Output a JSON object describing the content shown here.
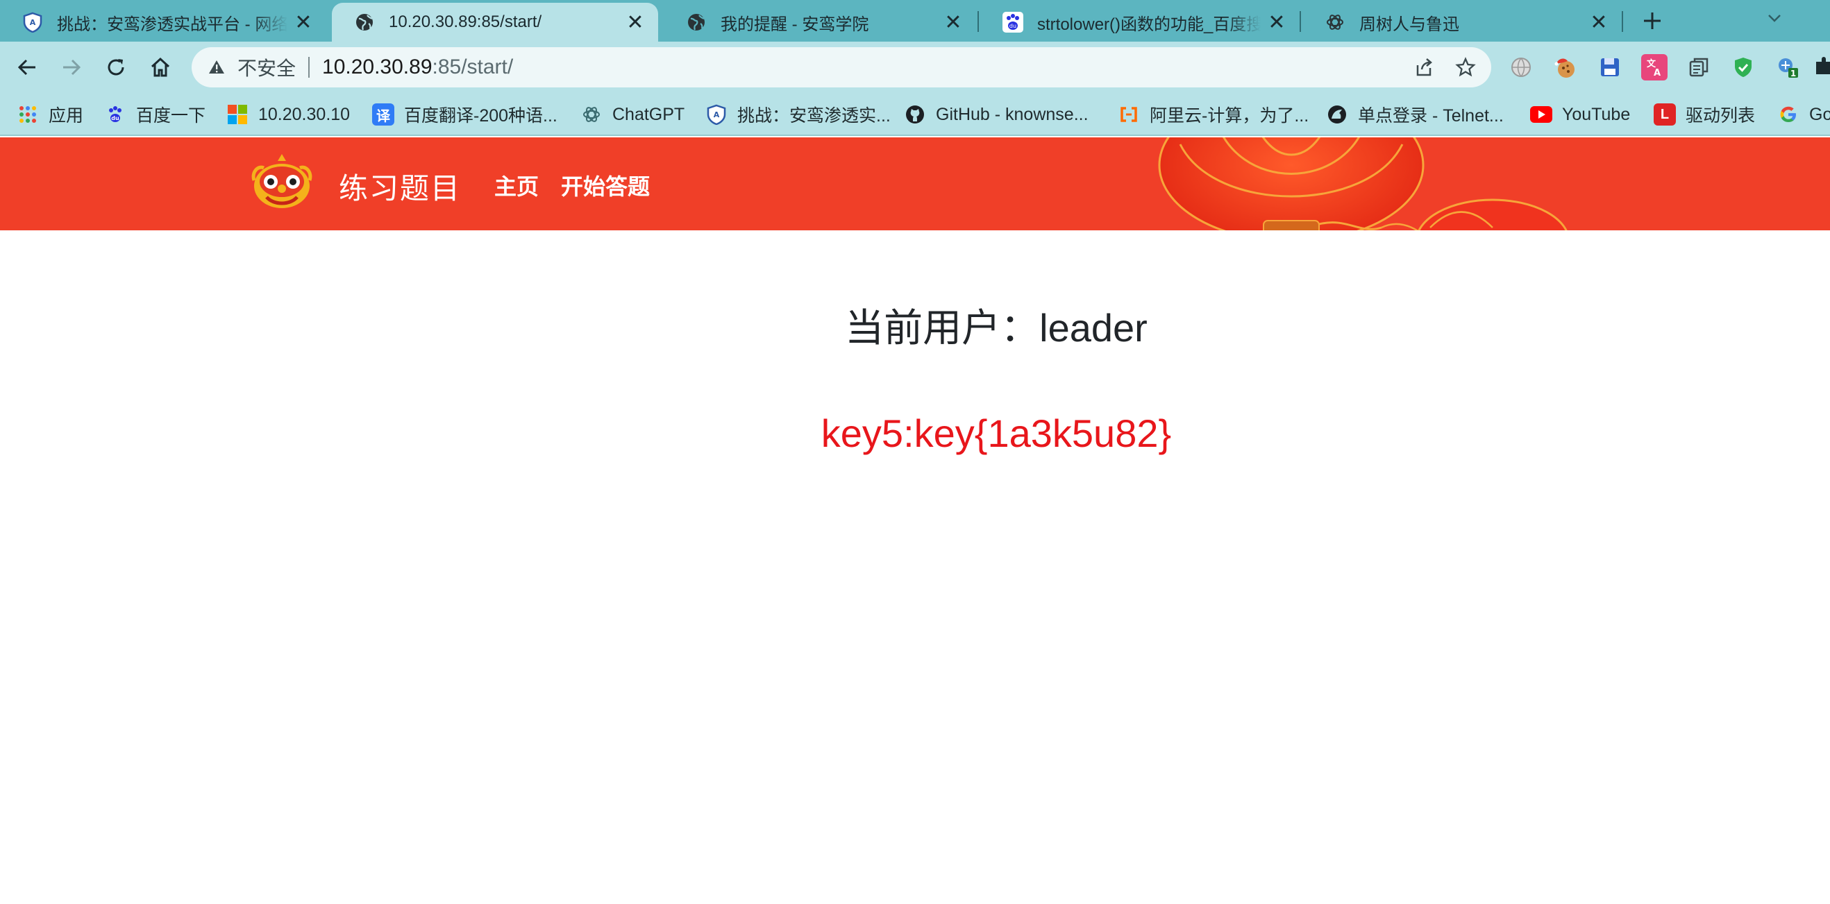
{
  "browser": {
    "tabs": [
      {
        "title": "挑战：安鸾渗透实战平台 - 网络",
        "icon": "shield-icon",
        "active": false
      },
      {
        "title": "10.20.30.89:85/start/",
        "icon": "globe-icon",
        "active": true
      },
      {
        "title": "我的提醒 - 安鸾学院",
        "icon": "globe-icon",
        "active": false
      },
      {
        "title": "strtolower()函数的功能_百度搜",
        "icon": "baidu-paw-icon",
        "active": false
      },
      {
        "title": "周树人与鲁迅",
        "icon": "chatgpt-icon",
        "active": false
      }
    ],
    "address_bar": {
      "security_label": "不安全",
      "host": "10.20.30.89",
      "path": ":85/start/"
    },
    "extension_badge": "1",
    "bookmarks": [
      {
        "label": "应用",
        "icon": "apps-grid-icon"
      },
      {
        "label": "百度一下",
        "icon": "baidu-paw-icon"
      },
      {
        "label": "10.20.30.10",
        "icon": "windows-logo-icon"
      },
      {
        "label": "百度翻译-200种语...",
        "icon": "translate-icon"
      },
      {
        "label": "ChatGPT",
        "icon": "chatgpt-icon"
      },
      {
        "label": "挑战：安鸾渗透实...",
        "icon": "shield-icon"
      },
      {
        "label": "GitHub - knownse...",
        "icon": "github-icon"
      },
      {
        "label": "阿里云-计算，为了...",
        "icon": "aliyun-icon"
      },
      {
        "label": "单点登录 - Telnet...",
        "icon": "telnet-icon"
      },
      {
        "label": "YouTube",
        "icon": "youtube-icon"
      },
      {
        "label": "驱动列表",
        "icon": "l-logo-icon"
      },
      {
        "label": "Go",
        "icon": "google-icon"
      }
    ]
  },
  "site": {
    "name": "练习题目",
    "nav": [
      "主页",
      "开始答题"
    ],
    "colors": {
      "header": "#f03f28",
      "key_text": "#e8161b"
    }
  },
  "main": {
    "user_label": "当前用户：",
    "username": "leader",
    "key_text": "key5:key{1a3k5u82}"
  }
}
